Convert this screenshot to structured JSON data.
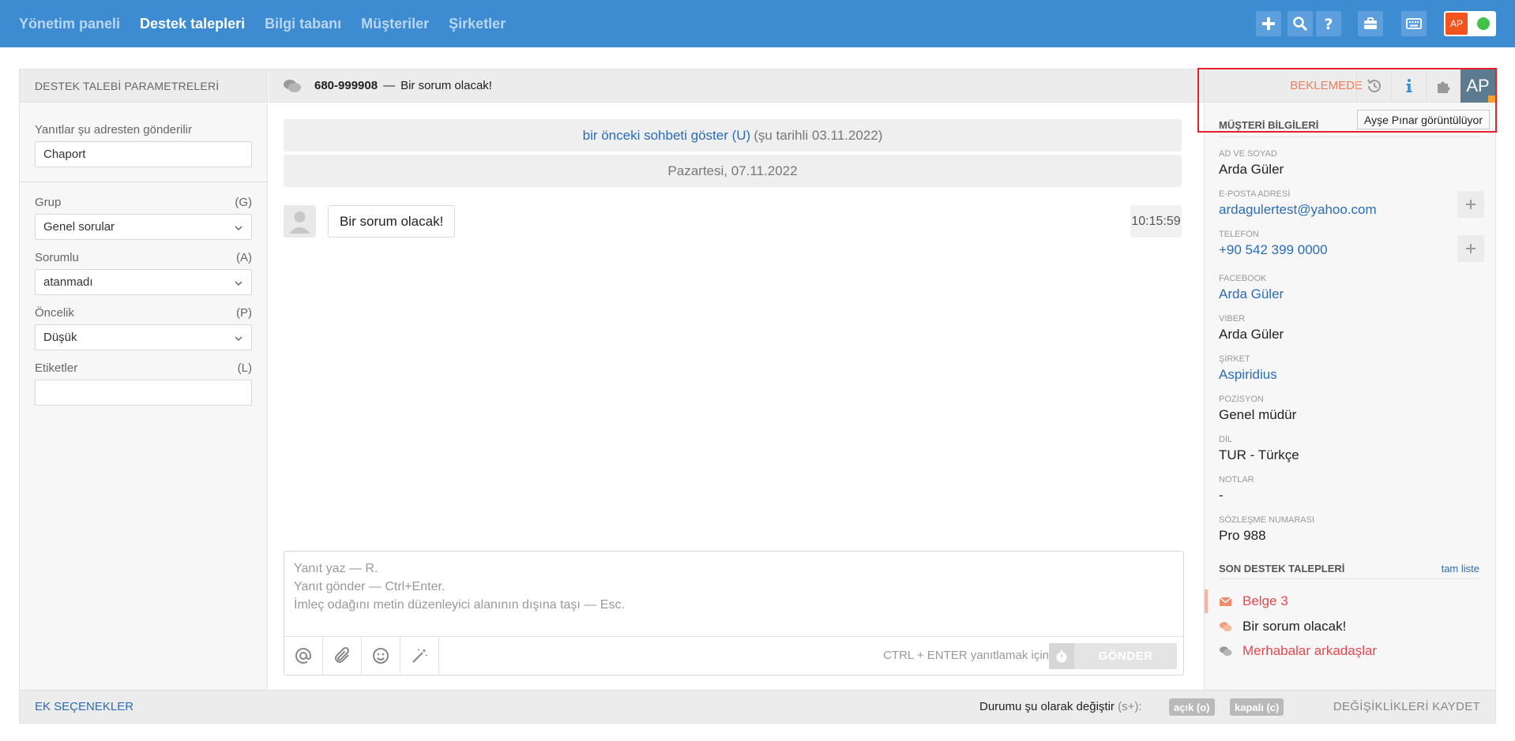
{
  "nav": {
    "items": [
      "Yönetim paneli",
      "Destek talepleri",
      "Bilgi tabanı",
      "Müşteriler",
      "Şirketler"
    ],
    "active_index": 1
  },
  "topbar": {
    "icons": [
      "plus-icon",
      "search-icon",
      "help-icon",
      "briefcase-icon",
      "keyboard-icon"
    ],
    "user_initials": "AP"
  },
  "left": {
    "header": "DESTEK TALEBİ PARAMETRELERİ",
    "reply_from_label": "Yanıtlar şu adresten gönderilir",
    "reply_from_value": "Chaport",
    "group_label": "Grup",
    "group_shortcut": "(G)",
    "group_value": "Genel sorular",
    "owner_label": "Sorumlu",
    "owner_shortcut": "(A)",
    "owner_value": "atanmadı",
    "priority_label": "Öncelik",
    "priority_shortcut": "(P)",
    "priority_value": "Düşük",
    "tags_label": "Etiketler",
    "tags_shortcut": "(L)",
    "tags_value": ""
  },
  "chat": {
    "ticket_id": "680-999908",
    "separator": "—",
    "subject": "Bir sorum olacak!",
    "prev_link": "bir önceki sohbeti göster (U)",
    "prev_date": "(şu tarihli 03.11.2022)",
    "date_divider": "Pazartesi, 07.11.2022",
    "message_text": "Bir sorum olacak!",
    "message_time": "10:15:59",
    "composer_placeholder": "Yanıt yaz — R.\nYanıt gönder — Ctrl+Enter.\nİmleç odağını metin düzenleyici alanının dışına taşı — Esc.",
    "hint": "CTRL + ENTER yanıtlamak için",
    "send_label": "GÖNDER"
  },
  "right": {
    "status": "BEKLEMEDE",
    "avatar_initials": "AP",
    "tooltip": "Ayşe Pınar görüntülüyor",
    "section_title": "MÜŞTERİ BİLGİLERİ",
    "fields": [
      {
        "label": "AD VE SOYAD",
        "value": "Arda Güler",
        "link": false
      },
      {
        "label": "E-POSTA ADRESİ",
        "value": "ardagulertest@yahoo.com",
        "link": true
      },
      {
        "label": "TELEFON",
        "value": "+90 542 399 0000",
        "link": true
      },
      {
        "label": "FACEBOOK",
        "value": "Arda Güler",
        "link": true
      },
      {
        "label": "VIBER",
        "value": "Arda Güler",
        "link": false
      },
      {
        "label": "ŞİRKET",
        "value": "Aspiridius",
        "link": true
      },
      {
        "label": "POZİSYON",
        "value": "Genel müdür",
        "link": false
      },
      {
        "label": "DİL",
        "value": "TUR - Türkçe",
        "link": false
      },
      {
        "label": "NOTLAR",
        "value": "-",
        "link": false
      },
      {
        "label": "SÖZLEŞME NUMARASI",
        "value": "Pro 988",
        "link": false
      }
    ],
    "tickets_title": "SON DESTEK TALEPLERİ",
    "tickets_link": "tam liste",
    "tickets": [
      {
        "title": "Belge 3",
        "icon": "envelope-icon",
        "color": "#e3484f"
      },
      {
        "title": "Bir sorum olacak!",
        "icon": "chat-bubbles-icon",
        "color": "#222222"
      },
      {
        "title": "Merhabalar arkadaşlar",
        "icon": "chat-bubbles-icon",
        "color": "#e3484f"
      }
    ]
  },
  "footer": {
    "more_options": "EK SEÇENEKLER",
    "change_status": "Durumu şu olarak değiştir",
    "change_status_shortcut": "(s+):",
    "open_label": "açık (o)",
    "closed_label": "kapalı (c)",
    "save": "DEĞİŞİKLİKLERİ KAYDET"
  },
  "colors": {
    "topbar": "#3d8bd0",
    "link": "#2b6cb5",
    "status": "#f07d5c",
    "highlight": "#e8202a"
  }
}
